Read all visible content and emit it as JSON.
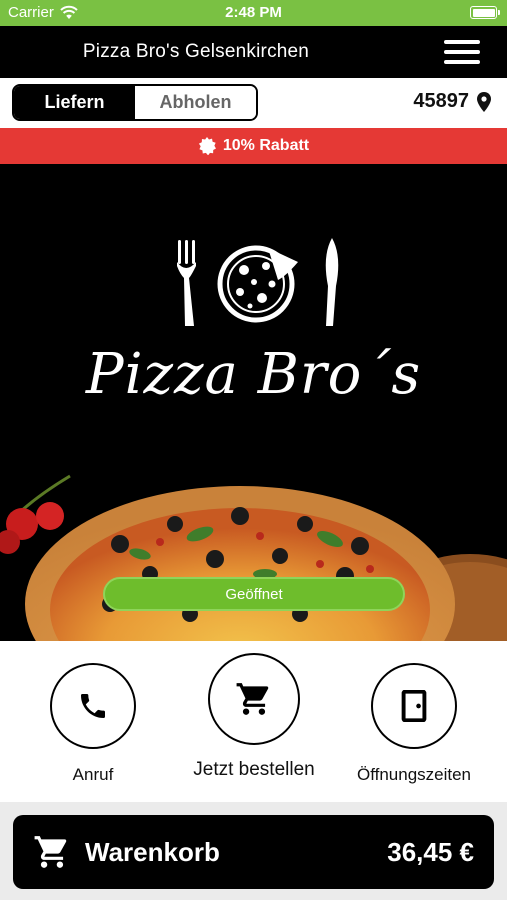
{
  "status_bar": {
    "carrier": "Carrier",
    "time": "2:48 PM"
  },
  "header": {
    "title": "Pizza Bro's Gelsenkirchen",
    "menu_icon": "hamburger-menu-icon"
  },
  "order_mode": {
    "options": [
      "Liefern",
      "Abholen"
    ],
    "selected": "Liefern"
  },
  "location": {
    "zip": "45897",
    "icon": "map-pin-icon"
  },
  "promo": {
    "text": "10% Rabatt",
    "icon": "discount-badge-icon"
  },
  "hero": {
    "logo_text": "Pizza Bro´s",
    "status": "Geöffnet"
  },
  "actions": [
    {
      "label": "Anruf",
      "icon": "phone-icon"
    },
    {
      "label": "Jetzt bestellen",
      "icon": "shopping-cart-icon"
    },
    {
      "label": "Öffnungszeiten",
      "icon": "door-icon"
    }
  ],
  "cart": {
    "label": "Warenkorb",
    "total": "36,45 €",
    "icon": "shopping-cart-icon"
  },
  "colors": {
    "status_bar": "#7ac143",
    "promo": "#e53935",
    "open_status": "#6ebd2c",
    "header": "#000000"
  }
}
